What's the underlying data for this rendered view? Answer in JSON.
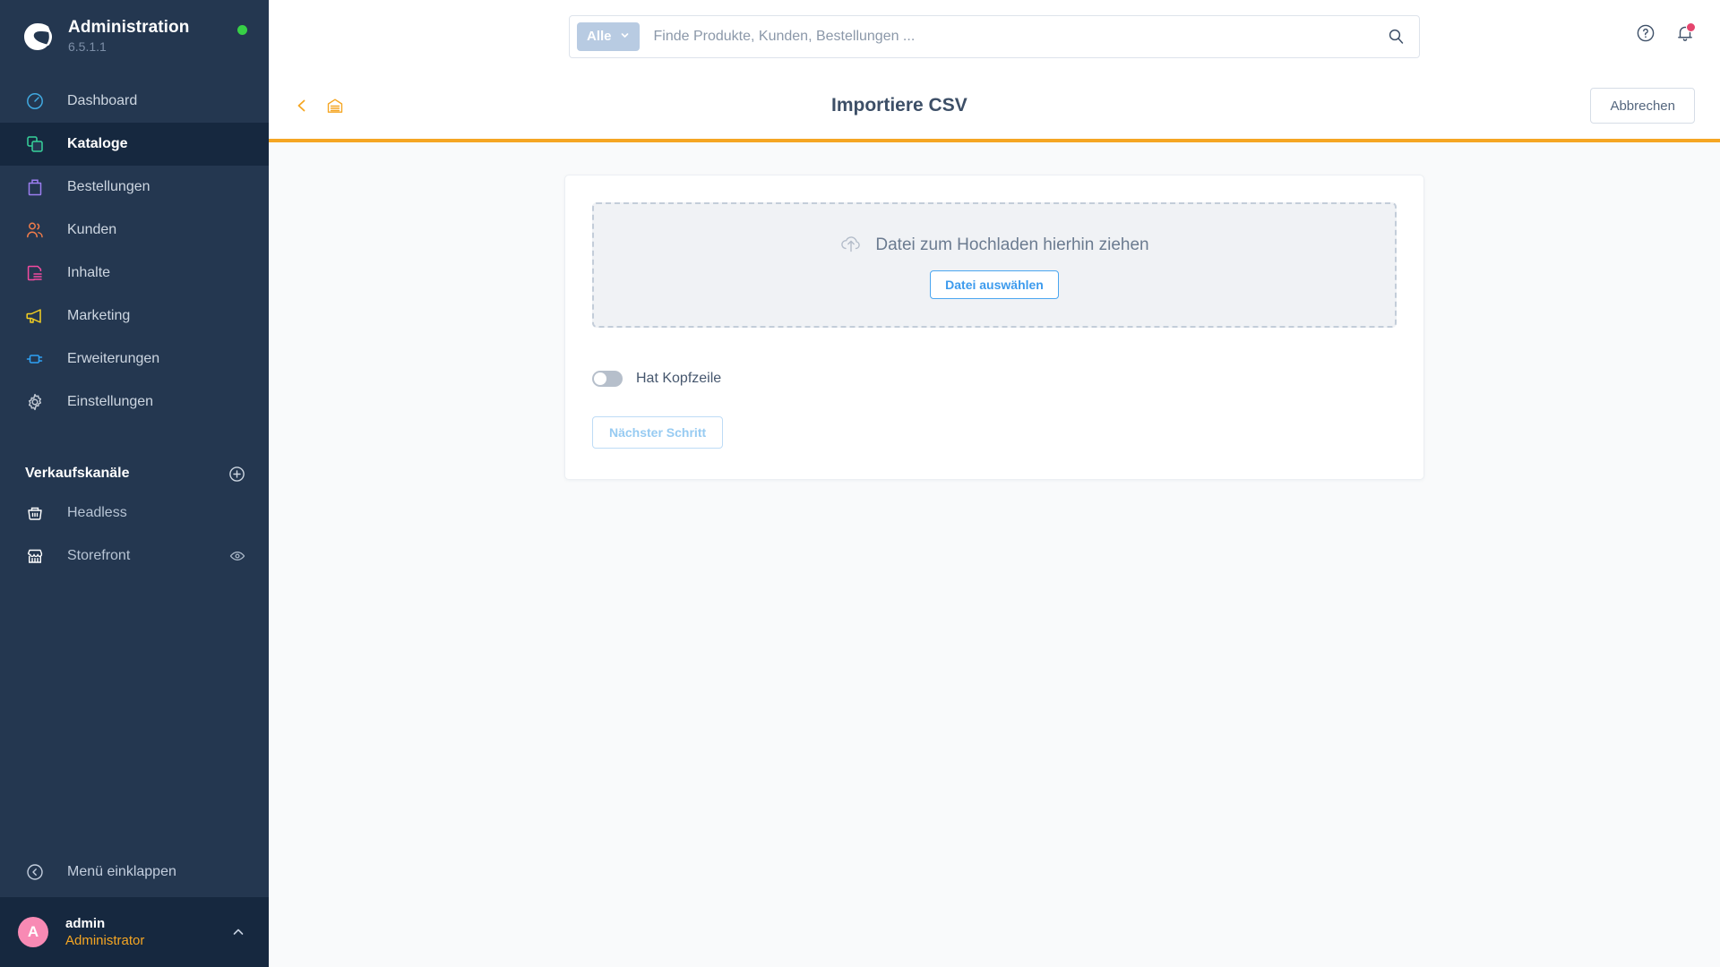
{
  "sidebar": {
    "brand": {
      "title": "Administration",
      "version": "6.5.1.1",
      "logo_icon": "shopware-logo-icon",
      "status_icon": "status-online-dot"
    },
    "items": [
      {
        "label": "Dashboard",
        "icon": "dashboard-icon",
        "color": "#41a9e0",
        "active": false
      },
      {
        "label": "Kataloge",
        "icon": "catalog-icon",
        "color": "#37d29b",
        "active": true
      },
      {
        "label": "Bestellungen",
        "icon": "orders-bag-icon",
        "color": "#9b7ef0",
        "active": false
      },
      {
        "label": "Kunden",
        "icon": "customers-icon",
        "color": "#f07c4a",
        "active": false
      },
      {
        "label": "Inhalte",
        "icon": "content-icon",
        "color": "#f24aa0",
        "active": false
      },
      {
        "label": "Marketing",
        "icon": "megaphone-icon",
        "color": "#f5d020",
        "active": false
      },
      {
        "label": "Erweiterungen",
        "icon": "plugin-icon",
        "color": "#2ea2f5",
        "active": false
      },
      {
        "label": "Einstellungen",
        "icon": "gear-icon",
        "color": "#c0c8d3",
        "active": false
      }
    ],
    "sales_channels": {
      "title": "Verkaufskanäle",
      "add_icon": "plus-circle-icon",
      "items": [
        {
          "label": "Headless",
          "icon": "basket-icon",
          "trailing_icon": ""
        },
        {
          "label": "Storefront",
          "icon": "storefront-icon",
          "trailing_icon": "eye-icon"
        }
      ]
    },
    "collapse": {
      "label": "Menü einklappen",
      "icon": "collapse-left-icon"
    },
    "user": {
      "avatar_initial": "A",
      "name": "admin",
      "role": "Administrator",
      "chevron_icon": "chevron-up-icon"
    }
  },
  "topbar": {
    "search": {
      "scope_label": "Alle",
      "scope_chevron_icon": "chevron-down-icon",
      "placeholder": "Finde Produkte, Kunden, Bestellungen ...",
      "value": "",
      "search_icon": "search-icon"
    },
    "help_icon": "help-circle-icon",
    "notifications_icon": "bell-icon"
  },
  "pageheader": {
    "back_icon": "chevron-left-icon",
    "module_icon": "warehouse-icon",
    "title": "Importiere CSV",
    "cancel_label": "Abbrechen"
  },
  "main": {
    "dropzone": {
      "upload_icon": "cloud-upload-icon",
      "text": "Datei zum Hochladen hierhin ziehen",
      "choose_label": "Datei auswählen"
    },
    "header_switch": {
      "label": "Hat Kopfzeile",
      "checked": false
    },
    "next_label": "Nächster Schritt"
  },
  "colors": {
    "sidebar_bg": "#243750",
    "sidebar_active": "#16283f",
    "accent_orange": "#f5a623",
    "accent_blue": "#3d9bed",
    "notification_red": "#e5446d",
    "status_green": "#37d046",
    "avatar_pink": "#f88ab4"
  }
}
